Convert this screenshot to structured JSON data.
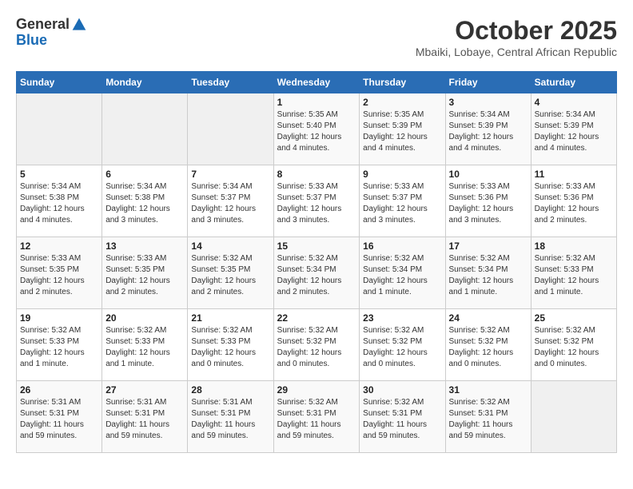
{
  "header": {
    "logo_line1": "General",
    "logo_line2": "Blue",
    "month": "October 2025",
    "location": "Mbaiki, Lobaye, Central African Republic"
  },
  "weekdays": [
    "Sunday",
    "Monday",
    "Tuesday",
    "Wednesday",
    "Thursday",
    "Friday",
    "Saturday"
  ],
  "weeks": [
    [
      {
        "day": "",
        "info": ""
      },
      {
        "day": "",
        "info": ""
      },
      {
        "day": "",
        "info": ""
      },
      {
        "day": "1",
        "info": "Sunrise: 5:35 AM\nSunset: 5:40 PM\nDaylight: 12 hours\nand 4 minutes."
      },
      {
        "day": "2",
        "info": "Sunrise: 5:35 AM\nSunset: 5:39 PM\nDaylight: 12 hours\nand 4 minutes."
      },
      {
        "day": "3",
        "info": "Sunrise: 5:34 AM\nSunset: 5:39 PM\nDaylight: 12 hours\nand 4 minutes."
      },
      {
        "day": "4",
        "info": "Sunrise: 5:34 AM\nSunset: 5:39 PM\nDaylight: 12 hours\nand 4 minutes."
      }
    ],
    [
      {
        "day": "5",
        "info": "Sunrise: 5:34 AM\nSunset: 5:38 PM\nDaylight: 12 hours\nand 4 minutes."
      },
      {
        "day": "6",
        "info": "Sunrise: 5:34 AM\nSunset: 5:38 PM\nDaylight: 12 hours\nand 3 minutes."
      },
      {
        "day": "7",
        "info": "Sunrise: 5:34 AM\nSunset: 5:37 PM\nDaylight: 12 hours\nand 3 minutes."
      },
      {
        "day": "8",
        "info": "Sunrise: 5:33 AM\nSunset: 5:37 PM\nDaylight: 12 hours\nand 3 minutes."
      },
      {
        "day": "9",
        "info": "Sunrise: 5:33 AM\nSunset: 5:37 PM\nDaylight: 12 hours\nand 3 minutes."
      },
      {
        "day": "10",
        "info": "Sunrise: 5:33 AM\nSunset: 5:36 PM\nDaylight: 12 hours\nand 3 minutes."
      },
      {
        "day": "11",
        "info": "Sunrise: 5:33 AM\nSunset: 5:36 PM\nDaylight: 12 hours\nand 2 minutes."
      }
    ],
    [
      {
        "day": "12",
        "info": "Sunrise: 5:33 AM\nSunset: 5:35 PM\nDaylight: 12 hours\nand 2 minutes."
      },
      {
        "day": "13",
        "info": "Sunrise: 5:33 AM\nSunset: 5:35 PM\nDaylight: 12 hours\nand 2 minutes."
      },
      {
        "day": "14",
        "info": "Sunrise: 5:32 AM\nSunset: 5:35 PM\nDaylight: 12 hours\nand 2 minutes."
      },
      {
        "day": "15",
        "info": "Sunrise: 5:32 AM\nSunset: 5:34 PM\nDaylight: 12 hours\nand 2 minutes."
      },
      {
        "day": "16",
        "info": "Sunrise: 5:32 AM\nSunset: 5:34 PM\nDaylight: 12 hours\nand 1 minute."
      },
      {
        "day": "17",
        "info": "Sunrise: 5:32 AM\nSunset: 5:34 PM\nDaylight: 12 hours\nand 1 minute."
      },
      {
        "day": "18",
        "info": "Sunrise: 5:32 AM\nSunset: 5:33 PM\nDaylight: 12 hours\nand 1 minute."
      }
    ],
    [
      {
        "day": "19",
        "info": "Sunrise: 5:32 AM\nSunset: 5:33 PM\nDaylight: 12 hours\nand 1 minute."
      },
      {
        "day": "20",
        "info": "Sunrise: 5:32 AM\nSunset: 5:33 PM\nDaylight: 12 hours\nand 1 minute."
      },
      {
        "day": "21",
        "info": "Sunrise: 5:32 AM\nSunset: 5:33 PM\nDaylight: 12 hours\nand 0 minutes."
      },
      {
        "day": "22",
        "info": "Sunrise: 5:32 AM\nSunset: 5:32 PM\nDaylight: 12 hours\nand 0 minutes."
      },
      {
        "day": "23",
        "info": "Sunrise: 5:32 AM\nSunset: 5:32 PM\nDaylight: 12 hours\nand 0 minutes."
      },
      {
        "day": "24",
        "info": "Sunrise: 5:32 AM\nSunset: 5:32 PM\nDaylight: 12 hours\nand 0 minutes."
      },
      {
        "day": "25",
        "info": "Sunrise: 5:32 AM\nSunset: 5:32 PM\nDaylight: 12 hours\nand 0 minutes."
      }
    ],
    [
      {
        "day": "26",
        "info": "Sunrise: 5:31 AM\nSunset: 5:31 PM\nDaylight: 11 hours\nand 59 minutes."
      },
      {
        "day": "27",
        "info": "Sunrise: 5:31 AM\nSunset: 5:31 PM\nDaylight: 11 hours\nand 59 minutes."
      },
      {
        "day": "28",
        "info": "Sunrise: 5:31 AM\nSunset: 5:31 PM\nDaylight: 11 hours\nand 59 minutes."
      },
      {
        "day": "29",
        "info": "Sunrise: 5:32 AM\nSunset: 5:31 PM\nDaylight: 11 hours\nand 59 minutes."
      },
      {
        "day": "30",
        "info": "Sunrise: 5:32 AM\nSunset: 5:31 PM\nDaylight: 11 hours\nand 59 minutes."
      },
      {
        "day": "31",
        "info": "Sunrise: 5:32 AM\nSunset: 5:31 PM\nDaylight: 11 hours\nand 59 minutes."
      },
      {
        "day": "",
        "info": ""
      }
    ]
  ]
}
